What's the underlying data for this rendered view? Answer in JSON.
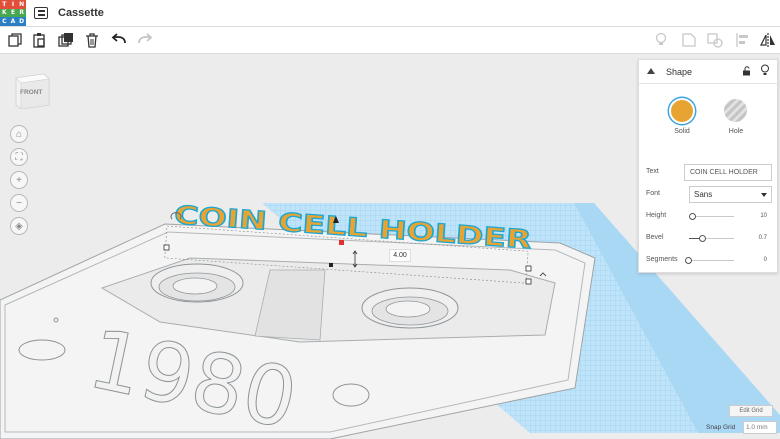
{
  "app": {
    "logo_letters": [
      "T",
      "I",
      "N",
      "K",
      "E",
      "R",
      "C",
      "A",
      "D"
    ],
    "logo_colors": [
      "#e14f3b",
      "#e14f3b",
      "#e14f3b",
      "#48a74f",
      "#48a74f",
      "#48a74f",
      "#2b7fc2",
      "#2b7fc2",
      "#2b7fc2"
    ],
    "design_title": "Cassette"
  },
  "toolbar": {
    "left_tools": [
      "copy-icon",
      "paste-icon",
      "duplicate-icon",
      "delete-icon",
      "undo-icon",
      "redo-icon"
    ],
    "right_tools": [
      "note-icon",
      "group-icon",
      "ungroup-icon",
      "align-icon",
      "mirror-icon"
    ]
  },
  "viewcube": {
    "face_label": "FRONT"
  },
  "nav_controls": [
    "home-view-icon",
    "fit-view-icon",
    "zoom-in-icon",
    "zoom-out-icon",
    "perspective-icon"
  ],
  "shape_panel": {
    "title": "Shape",
    "solid_label": "Solid",
    "hole_label": "Hole",
    "solid_color": "#e8a433",
    "properties": {
      "text_label": "Text",
      "text_value": "COIN CELL HOLDER",
      "font_label": "Font",
      "font_value": "Sans",
      "height_label": "Height",
      "height_value": "10",
      "bevel_label": "Bevel",
      "bevel_value": "0.7",
      "segments_label": "Segments",
      "segments_value": "0"
    }
  },
  "scene": {
    "text_object": "COIN CELL HOLDER",
    "engraved_year": "1980",
    "dimension_value": "4.00",
    "object_color": "#e8a433",
    "outline_color": "#1aa7d4"
  },
  "grid": {
    "edit_grid_label": "Edit Grid",
    "snap_grid_label": "Snap Grid",
    "snap_grid_value": "1.0 mm"
  }
}
